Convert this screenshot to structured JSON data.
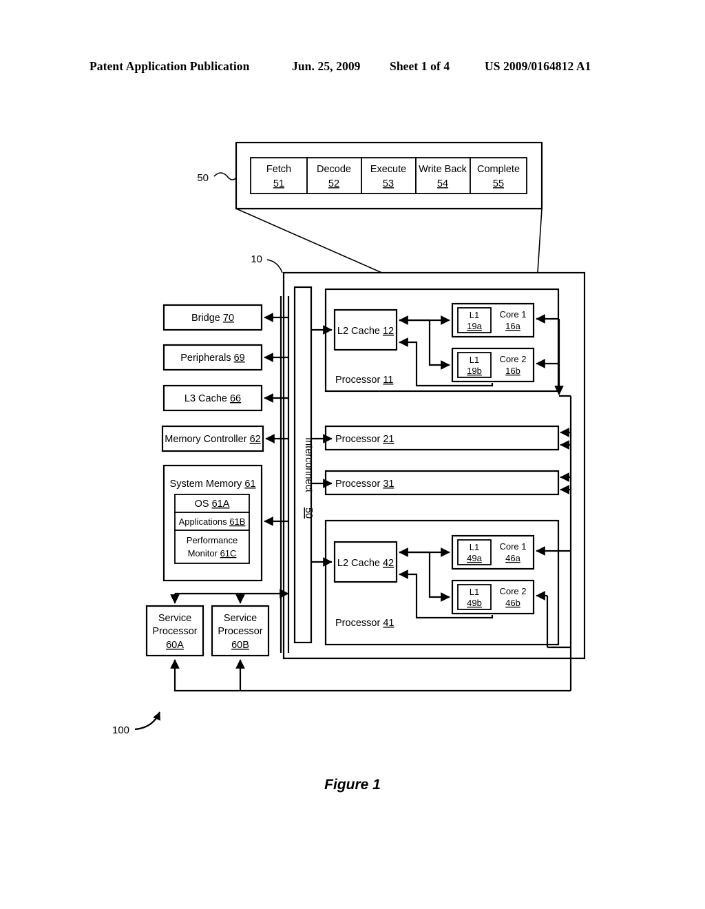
{
  "header": {
    "publication": "Patent Application Publication",
    "date": "Jun. 25, 2009",
    "sheet": "Sheet 1 of 4",
    "number": "US 2009/0164812 A1"
  },
  "figure": {
    "caption": "Figure 1",
    "system_ref": "100",
    "chip_ref": "10",
    "pipeline_ref": "50"
  },
  "pipeline": {
    "stages": [
      {
        "label": "Fetch",
        "ref": "51"
      },
      {
        "label": "Decode",
        "ref": "52"
      },
      {
        "label": "Execute",
        "ref": "53"
      },
      {
        "label": "Write Back",
        "ref": "54"
      },
      {
        "label": "Complete",
        "ref": "55"
      }
    ]
  },
  "interconnect": {
    "label": "Interconnect",
    "ref": "50"
  },
  "left_blocks": [
    {
      "label": "Bridge",
      "ref": "70"
    },
    {
      "label": "Peripherals",
      "ref": "69"
    },
    {
      "label": "L3 Cache",
      "ref": "66"
    },
    {
      "label": "Memory Controller",
      "ref": "62"
    }
  ],
  "system_memory": {
    "label": "System Memory",
    "ref": "61",
    "items": [
      {
        "label": "OS",
        "ref": "61A"
      },
      {
        "label": "Applications",
        "ref": "61B"
      },
      {
        "label": "Performance Monitor",
        "ref": "61C",
        "line1": "Performance",
        "line2": "Monitor"
      }
    ]
  },
  "service_processors": [
    {
      "line1": "Service",
      "line2": "Processor",
      "ref": "60A"
    },
    {
      "line1": "Service",
      "line2": "Processor",
      "ref": "60B"
    }
  ],
  "processors": [
    {
      "label": "Processor",
      "ref": "11",
      "l2": {
        "label": "L2 Cache",
        "ref": "12"
      },
      "cores": [
        {
          "l1_label": "L1",
          "l1_ref": "19a",
          "core_label": "Core 1",
          "core_ref": "16a"
        },
        {
          "l1_label": "L1",
          "l1_ref": "19b",
          "core_label": "Core 2",
          "core_ref": "16b"
        }
      ]
    },
    {
      "label": "Processor",
      "ref": "21"
    },
    {
      "label": "Processor",
      "ref": "31"
    },
    {
      "label": "Processor",
      "ref": "41",
      "l2": {
        "label": "L2 Cache",
        "ref": "42"
      },
      "cores": [
        {
          "l1_label": "L1",
          "l1_ref": "49a",
          "core_label": "Core 1",
          "core_ref": "46a"
        },
        {
          "l1_label": "L1",
          "l1_ref": "49b",
          "core_label": "Core 2",
          "core_ref": "46b"
        }
      ]
    }
  ],
  "colors": {
    "ink": "#000000",
    "paper": "#ffffff"
  }
}
